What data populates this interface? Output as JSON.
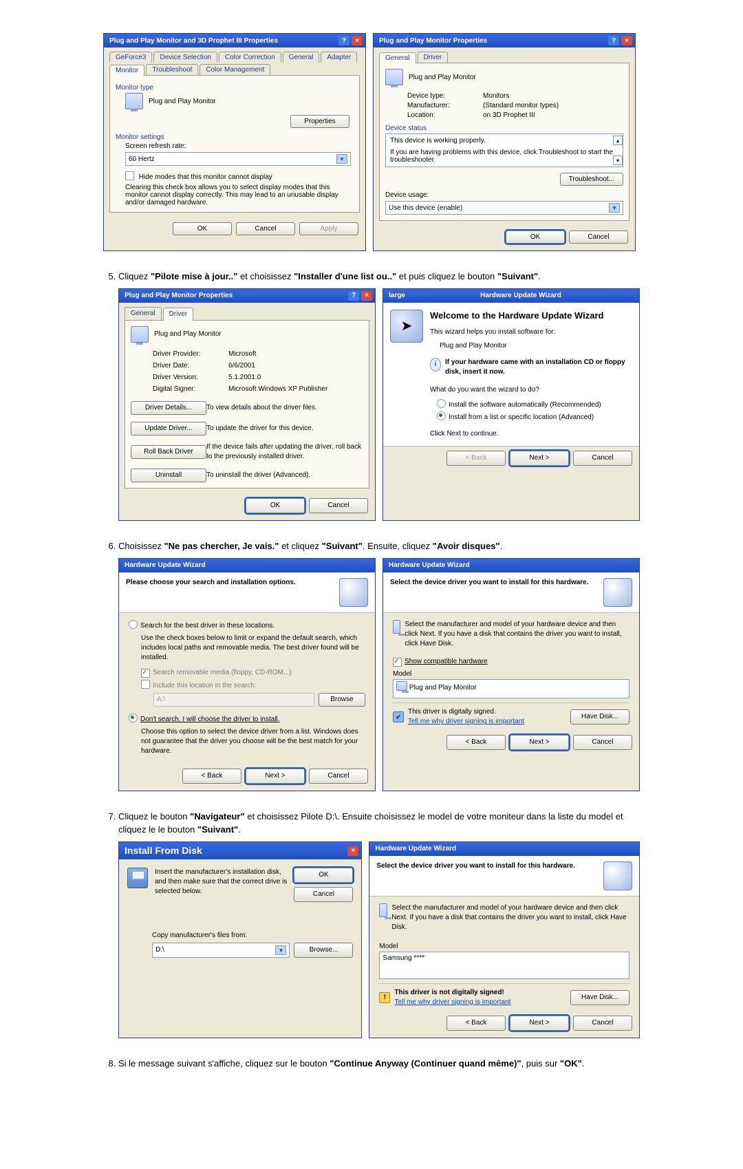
{
  "fig1": {
    "left": {
      "title": "Plug and Play Monitor and 3D Prophet III Properties",
      "tabs": [
        "GeForce3",
        "Device Selection",
        "Color Correction",
        "General",
        "Adapter",
        "Monitor",
        "Troubleshoot",
        "Color Management"
      ],
      "monitor_type_lbl": "Monitor type",
      "monitor_name": "Plug and Play Monitor",
      "properties_btn": "Properties",
      "monitor_settings_lbl": "Monitor settings",
      "refresh_lbl": "Screen refresh rate:",
      "refresh_value": "60 Hertz",
      "hide_modes": "Hide modes that this monitor cannot display",
      "hide_note": "Clearing this check box allows you to select display modes that this monitor cannot display correctly. This may lead to an unusable display and/or damaged hardware.",
      "ok": "OK",
      "cancel": "Cancel",
      "apply": "Apply"
    },
    "right": {
      "title": "Plug and Play Monitor Properties",
      "tab_general": "General",
      "tab_driver": "Driver",
      "header": "Plug and Play Monitor",
      "devtype_lbl": "Device type:",
      "devtype": "Monitors",
      "mfg_lbl": "Manufacturer:",
      "mfg": "(Standard monitor types)",
      "loc_lbl": "Location:",
      "loc": "on 3D Prophet III",
      "devstatus_lbl": "Device status",
      "status1": "This device is working properly.",
      "status2": "If you are having problems with this device, click Troubleshoot to start the troubleshooter.",
      "troubleshoot": "Troubleshoot...",
      "usage_lbl": "Device usage:",
      "usage_value": "Use this device (enable)",
      "ok": "OK",
      "cancel": "Cancel"
    }
  },
  "step5": {
    "p1": "Cliquez ",
    "b1": "\"Pilote mise à jour..\"",
    "p2": " et choisissez ",
    "b2": "\"Installer d'une list ou..\"",
    "p3": " et puis cliquez le bouton ",
    "b3": "\"Suivant\"",
    "p4": "."
  },
  "fig2": {
    "left": {
      "title": "Plug and Play Monitor Properties",
      "tab_general": "General",
      "tab_driver": "Driver",
      "header": "Plug and Play Monitor",
      "prov_lbl": "Driver Provider:",
      "prov": "Microsoft",
      "date_lbl": "Driver Date:",
      "date": "6/6/2001",
      "ver_lbl": "Driver Version:",
      "ver": "5.1.2001.0",
      "sign_lbl": "Digital Signer:",
      "sign": "Microsoft Windows XP Publisher",
      "details_btn": "Driver Details...",
      "details_txt": "To view details about the driver files.",
      "update_btn": "Update Driver...",
      "update_txt": "To update the driver for this device.",
      "rollback_btn": "Roll Back Driver",
      "rollback_txt": "If the device fails after updating the driver, roll back to the previously installed driver.",
      "uninstall_btn": "Uninstall",
      "uninstall_txt": "To uninstall the driver (Advanced).",
      "ok": "OK",
      "cancel": "Cancel"
    },
    "right": {
      "title": "Hardware Update Wizard",
      "heading": "Welcome to the Hardware Update Wizard",
      "line1": "This wizard helps you install software for:",
      "device": "Plug and Play Monitor",
      "cd_hint": "If your hardware came with an installation CD or floppy disk, insert it now.",
      "q": "What do you want the wizard to do?",
      "opt1": "Install the software automatically (Recommended)",
      "opt2": "Install from a list or specific location (Advanced)",
      "cont": "Click Next to continue.",
      "back": "< Back",
      "next": "Next >",
      "cancel": "Cancel"
    }
  },
  "step6": {
    "p1": "Choisissez ",
    "b1": "\"Ne pas chercher, Je vais.\"",
    "p2": " et cliquez ",
    "b2": "\"Suivant\"",
    "p3": ". Ensuite, cliquez ",
    "b3": "\"Avoir disques\"",
    "p4": "."
  },
  "fig3": {
    "left": {
      "title": "Hardware Update Wizard",
      "heading": "Please choose your search and installation options.",
      "opt_search": "Search for the best driver in these locations.",
      "search_note": "Use the check boxes below to limit or expand the default search, which includes local paths and removable media. The best driver found will be installed.",
      "cb1": "Search removable media (floppy, CD-ROM...)",
      "cb2": "Include this location in the search:",
      "path": "A:\\",
      "browse": "Browse",
      "opt_dont": "Don't search. I will choose the driver to install.",
      "dont_note": "Choose this option to select the device driver from a list. Windows does not guarantee that the driver you choose will be the best match for your hardware.",
      "back": "< Back",
      "next": "Next >",
      "cancel": "Cancel"
    },
    "right": {
      "title": "Hardware Update Wizard",
      "heading": "Select the device driver you want to install for this hardware.",
      "instr": "Select the manufacturer and model of your hardware device and then click Next. If you have a disk that contains the driver you want to install, click Have Disk.",
      "compat": "Show compatible hardware",
      "model_lbl": "Model",
      "model": "Plug and Play Monitor",
      "signed": "This driver is digitally signed.",
      "tellwhy": "Tell me why driver signing is important",
      "have": "Have Disk...",
      "back": "< Back",
      "next": "Next >",
      "cancel": "Cancel"
    }
  },
  "step7": {
    "p1": "Cliquez le bouton ",
    "b1": "\"Navigateur\"",
    "p2": " et choisissez Pilote D:\\. Ensuite choisissez le model de votre moniteur dans la liste du model et cliquez le le bouton ",
    "b2": "\"Suivant\"",
    "p3": "."
  },
  "fig4": {
    "left": {
      "title": "Install From Disk",
      "text": "Insert the manufacturer's installation disk, and then make sure that the correct drive is selected below.",
      "ok": "OK",
      "cancel": "Cancel",
      "copy_lbl": "Copy manufacturer's files from:",
      "path": "D:\\",
      "browse": "Browse..."
    },
    "right": {
      "title": "Hardware Update Wizard",
      "heading": "Select the device driver you want to install for this hardware.",
      "instr": "Select the manufacturer and model of your hardware device and then click Next. If you have a disk that contains the driver you want to install, click Have Disk.",
      "model_lbl": "Model",
      "model": "Samsung ****",
      "not_signed": "This driver is not digitally signed!",
      "tellwhy": "Tell me why driver signing is important",
      "have": "Have Disk...",
      "back": "< Back",
      "next": "Next >",
      "cancel": "Cancel"
    }
  },
  "step8": {
    "p1": "Si le message suivant s'affiche, cliquez sur le bouton ",
    "b1": "\"Continue Anyway (Continuer quand même)\"",
    "p2": ", puis sur ",
    "b2": "\"OK\"",
    "p3": "."
  }
}
